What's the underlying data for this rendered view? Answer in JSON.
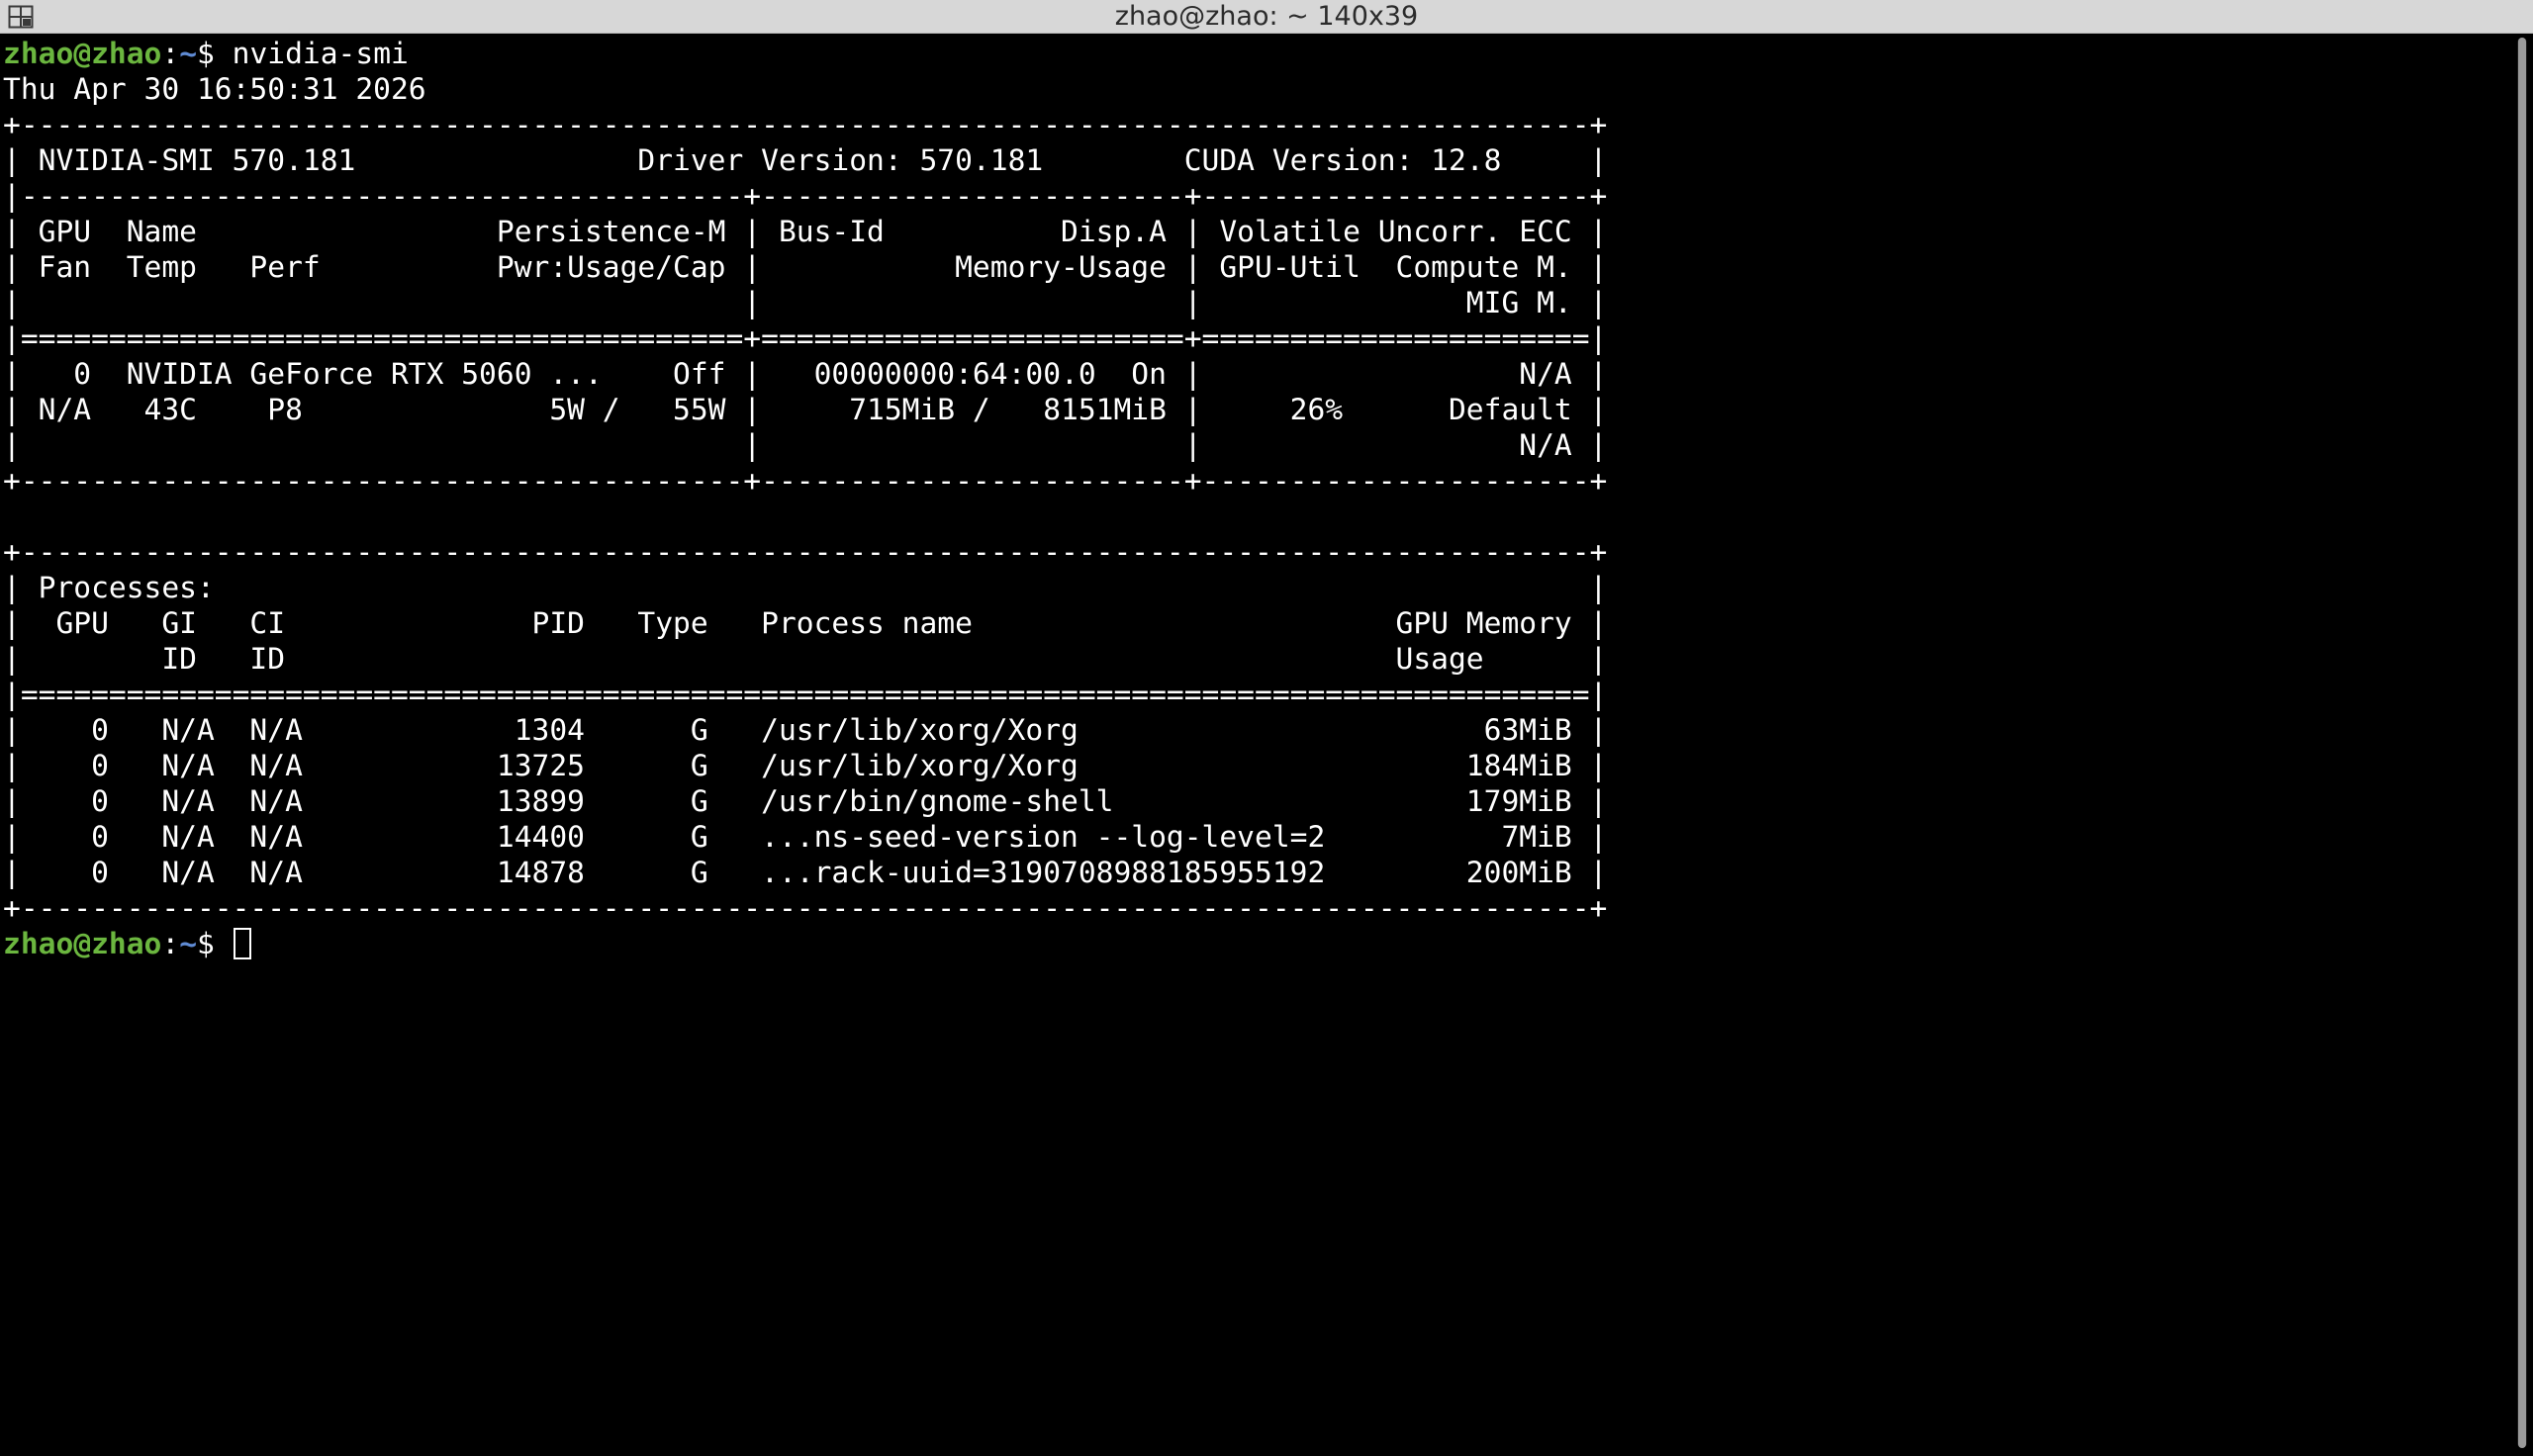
{
  "window": {
    "title": "zhao@zhao: ~ 140x39"
  },
  "prompt": {
    "user_host": "zhao@zhao",
    "colon": ":",
    "path": "~",
    "symbol": "$ "
  },
  "command": "nvidia-smi",
  "output": {
    "date": "Thu Apr 30 16:50:31 2026",
    "lines": [
      "+-----------------------------------------------------------------------------------------+",
      "| NVIDIA-SMI 570.181                Driver Version: 570.181        CUDA Version: 12.8     |",
      "|-----------------------------------------+------------------------+----------------------+",
      "| GPU  Name                 Persistence-M | Bus-Id          Disp.A | Volatile Uncorr. ECC |",
      "| Fan  Temp   Perf          Pwr:Usage/Cap |           Memory-Usage | GPU-Util  Compute M. |",
      "|                                         |                        |               MIG M. |",
      "|=========================================+========================+======================|",
      "|   0  NVIDIA GeForce RTX 5060 ...    Off |   00000000:64:00.0  On |                  N/A |",
      "| N/A   43C    P8              5W /   55W |     715MiB /   8151MiB |     26%      Default |",
      "|                                         |                        |                  N/A |",
      "+-----------------------------------------+------------------------+----------------------+",
      "",
      "+-----------------------------------------------------------------------------------------+",
      "| Processes:                                                                              |",
      "|  GPU   GI   CI              PID   Type   Process name                        GPU Memory |",
      "|        ID   ID                                                               Usage      |",
      "|=========================================================================================|",
      "|    0   N/A  N/A            1304      G   /usr/lib/xorg/Xorg                       63MiB |",
      "|    0   N/A  N/A           13725      G   /usr/lib/xorg/Xorg                      184MiB |",
      "|    0   N/A  N/A           13899      G   /usr/bin/gnome-shell                    179MiB |",
      "|    0   N/A  N/A           14400      G   ...ns-seed-version --log-level=2          7MiB |",
      "|    0   N/A  N/A           14878      G   ...rack-uuid=3190708988185955192        200MiB |",
      "+-----------------------------------------------------------------------------------------+"
    ]
  },
  "icons": {
    "titlebar": "terminal-menu-icon"
  },
  "colors": {
    "background": "#000000",
    "foreground": "#ffffff",
    "prompt_user": "#6bb63f",
    "prompt_path": "#5f8bd4",
    "titlebar": "#d7d7d7"
  }
}
